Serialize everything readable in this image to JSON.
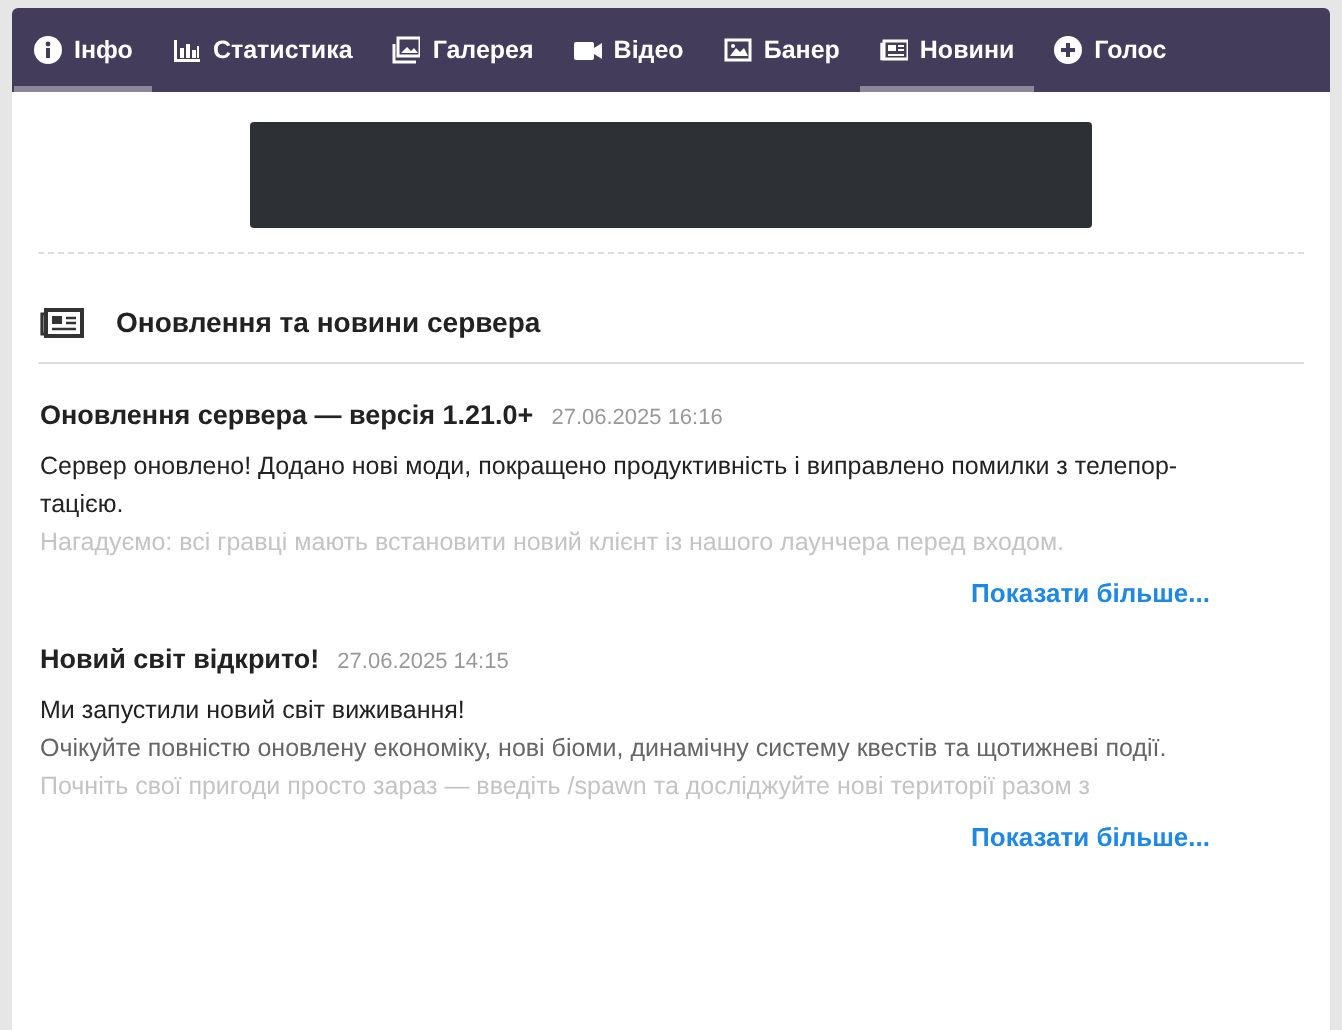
{
  "tabs": [
    {
      "label": "Інфо",
      "kind": "info",
      "selected": true
    },
    {
      "label": "Статистика",
      "kind": "chart",
      "selected": false
    },
    {
      "label": "Галерея",
      "kind": "gallery",
      "selected": false
    },
    {
      "label": "Відео",
      "kind": "video",
      "selected": false
    },
    {
      "label": "Банер",
      "kind": "image",
      "selected": false
    },
    {
      "label": "Новини",
      "kind": "news",
      "selected": true
    },
    {
      "label": "Голос",
      "kind": "plus",
      "selected": false
    }
  ],
  "section": {
    "title": "Оновлення та новини сервера"
  },
  "posts": [
    {
      "title": "Оновлення сервера — версія 1.21.0+",
      "date": "27.06.2025 16:16",
      "lines": [
        {
          "text": "Сервер оновлено! Додано нові моди, покращено продуктивність і виправлено помилки з телепор-",
          "kind": "full"
        },
        {
          "text": "тацією.",
          "kind": "full"
        },
        {
          "text": "Нагадуємо: всі гравці мають встановити новий клієнт із нашого лаунчера перед входом.",
          "kind": "faded"
        }
      ],
      "more": "Показати більше..."
    },
    {
      "title": "Новий світ відкрито!",
      "date": "27.06.2025 14:15",
      "lines": [
        {
          "text": "Ми запустили новий світ виживання!",
          "kind": "full"
        },
        {
          "text": "Очікуйте повністю оновлену економіку, нові біоми, динамічну систему квестів та щотижневі події.",
          "kind": "dim"
        },
        {
          "text": "Почніть свої пригоди просто зараз — введіть /spawn та досліджуйте нові території разом з",
          "kind": "faded"
        }
      ],
      "more": "Показати більше..."
    }
  ]
}
